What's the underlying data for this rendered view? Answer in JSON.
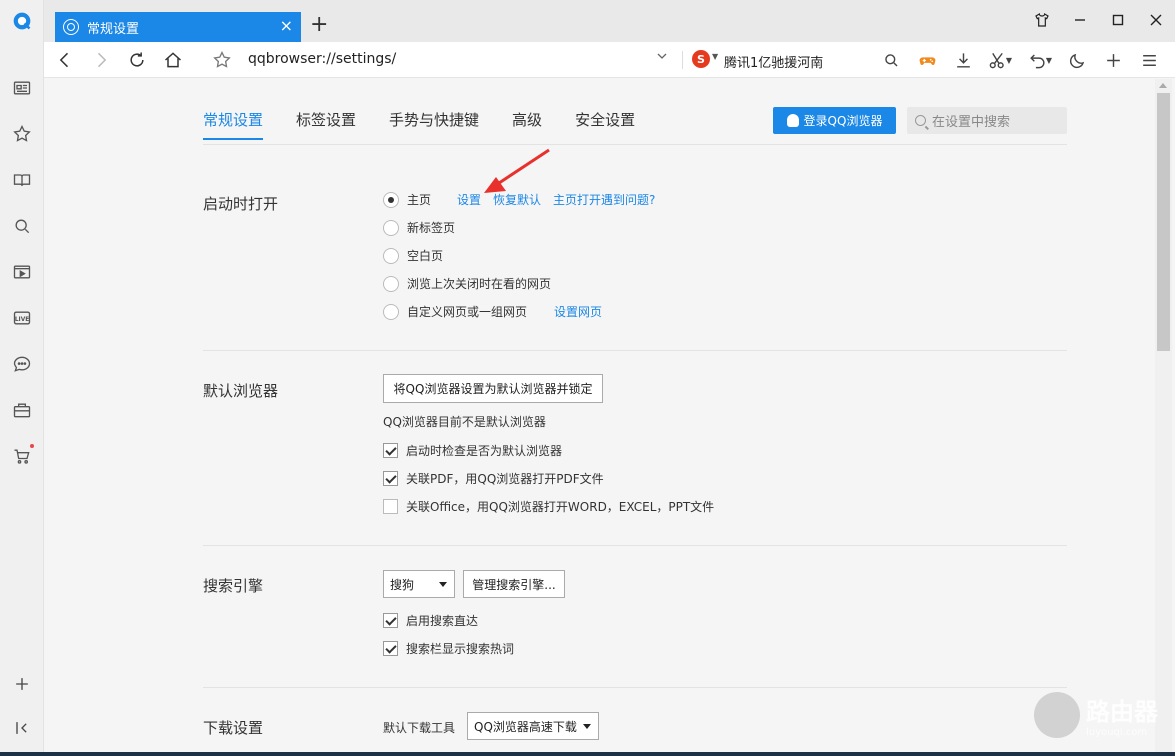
{
  "browser": {
    "tab_title": "常规设置",
    "url": "qqbrowser://settings/",
    "news_ticker": "腾讯1亿驰援河南",
    "accent_color": "#1b87e6"
  },
  "settings_nav": {
    "tabs": [
      "常规设置",
      "标签设置",
      "手势与快捷键",
      "高级",
      "安全设置"
    ],
    "login_label": "登录QQ浏览器",
    "search_placeholder": "在设置中搜索"
  },
  "startup": {
    "title": "启动时打开",
    "options": [
      "主页",
      "新标签页",
      "空白页",
      "浏览上次关闭时在看的网页",
      "自定义网页或一组网页"
    ],
    "home_links": [
      "设置",
      "恢复默认",
      "主页打开遇到问题?"
    ],
    "custom_link": "设置网页"
  },
  "default_browser": {
    "title": "默认浏览器",
    "set_button": "将QQ浏览器设置为默认浏览器并锁定",
    "status": "QQ浏览器目前不是默认浏览器",
    "checks": [
      {
        "label": "启动时检查是否为默认浏览器",
        "checked": true
      },
      {
        "label": "关联PDF，用QQ浏览器打开PDF文件",
        "checked": true
      },
      {
        "label": "关联Office，用QQ浏览器打开WORD，EXCEL，PPT文件",
        "checked": false
      }
    ]
  },
  "search_engine": {
    "title": "搜索引擎",
    "selected": "搜狗",
    "manage_button": "管理搜索引擎...",
    "checks": [
      {
        "label": "启用搜索直达",
        "checked": true
      },
      {
        "label": "搜索栏显示搜索热词",
        "checked": true
      }
    ]
  },
  "download": {
    "title": "下载设置",
    "tool_label": "默认下载工具",
    "tool_selected": "QQ浏览器高速下载"
  },
  "watermark": {
    "big": "路由器",
    "small": "luyouqi.com"
  }
}
